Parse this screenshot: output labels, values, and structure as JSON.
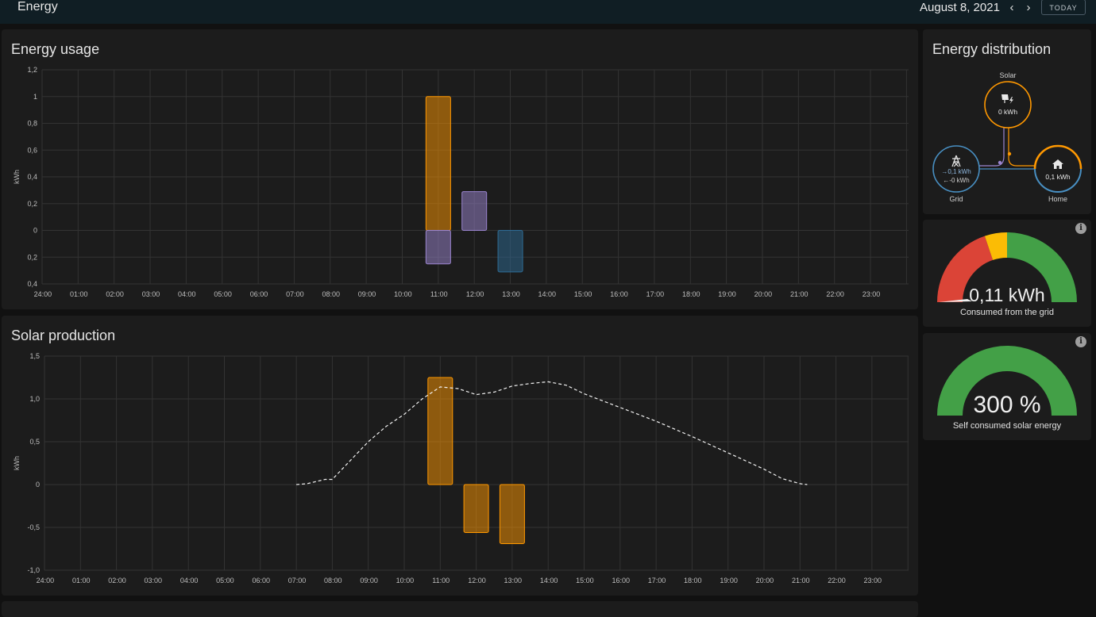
{
  "header": {
    "title": "Energy",
    "date": "August 8, 2021",
    "prev_icon": "chevron-left-icon",
    "next_icon": "chevron-right-icon",
    "today_label": "TODAY"
  },
  "energy_usage": {
    "title": "Energy usage",
    "chart_data": {
      "type": "bar",
      "ylabel": "kWh",
      "ylim": [
        -0.4,
        1.2
      ],
      "y_ticks": [
        "1,2",
        "1",
        "0,8",
        "0,6",
        "0,4",
        "0,2",
        "0",
        "0,2",
        "0,4"
      ],
      "x_ticks": [
        "24:00",
        "01:00",
        "02:00",
        "03:00",
        "04:00",
        "05:00",
        "06:00",
        "07:00",
        "08:00",
        "09:00",
        "10:00",
        "11:00",
        "12:00",
        "13:00",
        "14:00",
        "15:00",
        "16:00",
        "17:00",
        "18:00",
        "19:00",
        "20:00",
        "21:00",
        "22:00",
        "23:00"
      ],
      "grid": true,
      "bars": [
        {
          "hour": 11,
          "value": 1.0,
          "color": "#ff9800"
        },
        {
          "hour": 11,
          "value": -0.25,
          "color": "#9b85d0"
        },
        {
          "hour": 12,
          "value": 0.29,
          "color": "#9b85d0"
        },
        {
          "hour": 13,
          "value": -0.31,
          "color": "#2e6c96"
        }
      ]
    }
  },
  "solar_production": {
    "title": "Solar production",
    "chart_data": {
      "type": "bar",
      "ylabel": "kWh",
      "ylim": [
        -1.0,
        1.5
      ],
      "y_ticks": [
        "1,5",
        "1,0",
        "0,5",
        "0",
        "-0,5",
        "-1,0"
      ],
      "x_ticks": [
        "24:00",
        "01:00",
        "02:00",
        "03:00",
        "04:00",
        "05:00",
        "06:00",
        "07:00",
        "08:00",
        "09:00",
        "10:00",
        "11:00",
        "12:00",
        "13:00",
        "14:00",
        "15:00",
        "16:00",
        "17:00",
        "18:00",
        "19:00",
        "20:00",
        "21:00",
        "22:00",
        "23:00"
      ],
      "grid": true,
      "bars": [
        {
          "hour": 11,
          "value": 1.25,
          "color": "#ff9800"
        },
        {
          "hour": 12,
          "value": -0.56,
          "color": "#ff9800"
        },
        {
          "hour": 13,
          "value": -0.69,
          "color": "#ff9800"
        }
      ],
      "forecast_line": {
        "style": "dashed",
        "x": [
          7.0,
          7.3,
          7.8,
          8.0,
          8.5,
          9.0,
          9.5,
          10.0,
          10.5,
          11.0,
          11.5,
          12.0,
          12.5,
          13.0,
          13.5,
          14.0,
          14.5,
          15.0,
          16.0,
          17.0,
          18.0,
          19.0,
          20.0,
          20.5,
          21.0,
          21.2
        ],
        "y": [
          0.0,
          0.01,
          0.06,
          0.06,
          0.28,
          0.5,
          0.68,
          0.82,
          1.0,
          1.14,
          1.12,
          1.05,
          1.08,
          1.15,
          1.18,
          1.2,
          1.16,
          1.06,
          0.9,
          0.74,
          0.56,
          0.37,
          0.18,
          0.07,
          0.01,
          0.0
        ]
      }
    }
  },
  "distribution": {
    "title": "Energy distribution",
    "solar": {
      "label": "Solar",
      "value": "0 kWh",
      "icon": "solar-panel-icon",
      "color": "#ff9800"
    },
    "grid": {
      "label": "Grid",
      "in_value": "→0,1 kWh",
      "out_value": "←-0 kWh",
      "icon": "transmission-tower-icon",
      "color": "#488fc2"
    },
    "home": {
      "label": "Home",
      "value": "0,1 kWh",
      "icon": "home-icon",
      "color": "#ff9800"
    }
  },
  "gauge_grid": {
    "value": "0,11 kWh",
    "label": "Consumed from the grid",
    "level": 0.02,
    "segments": [
      "#db4437",
      "#ffb300",
      "#43a047"
    ]
  },
  "gauge_solar": {
    "value": "300 %",
    "label": "Self consumed solar energy",
    "level": 1.0,
    "color": "#43a047"
  }
}
